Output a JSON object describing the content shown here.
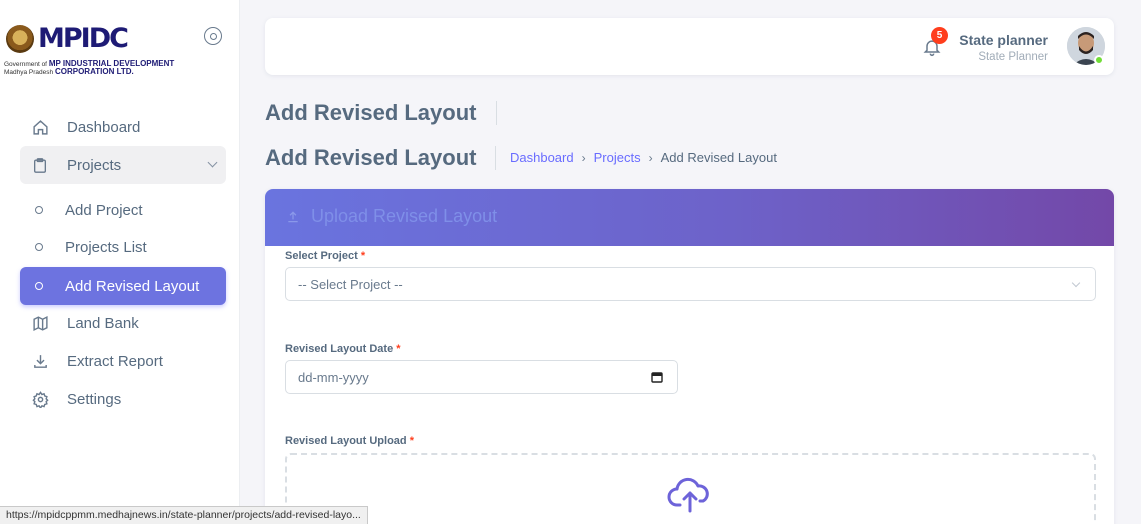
{
  "brand": {
    "logo_text": "MPIDC",
    "subtitle_line1_small": "Government of",
    "subtitle_line1_bold": "MP INDUSTRIAL DEVELOPMENT",
    "subtitle_line2_small": "Madhya Pradesh",
    "subtitle_line2_bold": "CORPORATION LTD."
  },
  "sidebar": {
    "items": [
      {
        "label": "Dashboard",
        "icon": "home-icon"
      },
      {
        "label": "Projects",
        "icon": "clipboard-icon"
      },
      {
        "label": "Add Project",
        "icon": "bullet-icon"
      },
      {
        "label": "Projects List",
        "icon": "bullet-icon"
      },
      {
        "label": "Add Revised Layout",
        "icon": "bullet-icon"
      },
      {
        "label": "Land Bank",
        "icon": "map-icon"
      },
      {
        "label": "Extract Report",
        "icon": "download-icon"
      },
      {
        "label": "Settings",
        "icon": "gear-icon"
      }
    ]
  },
  "navbar": {
    "notification_count": "5",
    "user_name": "State planner",
    "user_role": "State Planner"
  },
  "page": {
    "title_top": "Add Revised Layout",
    "title": "Add Revised Layout",
    "breadcrumb": {
      "dashboard": "Dashboard",
      "separator": "›",
      "projects": "Projects",
      "current": "Add Revised Layout"
    }
  },
  "card": {
    "title": "Upload Revised Layout",
    "select_project_label": "Select Project",
    "select_project_value": "-- Select Project --",
    "date_label": "Revised Layout Date",
    "date_placeholder": "dd-mm-yyyy",
    "upload_label": "Revised Layout Upload",
    "required_mark": "*"
  },
  "status_url": "https://mpidcppmm.medhajnews.in/state-planner/projects/add-revised-layo...",
  "colors": {
    "accent": "#696cff",
    "active_item": "#6d73e0",
    "header_gradient_start": "#6a74df",
    "header_gradient_end": "#7348a8",
    "badge": "#ff3e1d",
    "online": "#71dd37"
  }
}
